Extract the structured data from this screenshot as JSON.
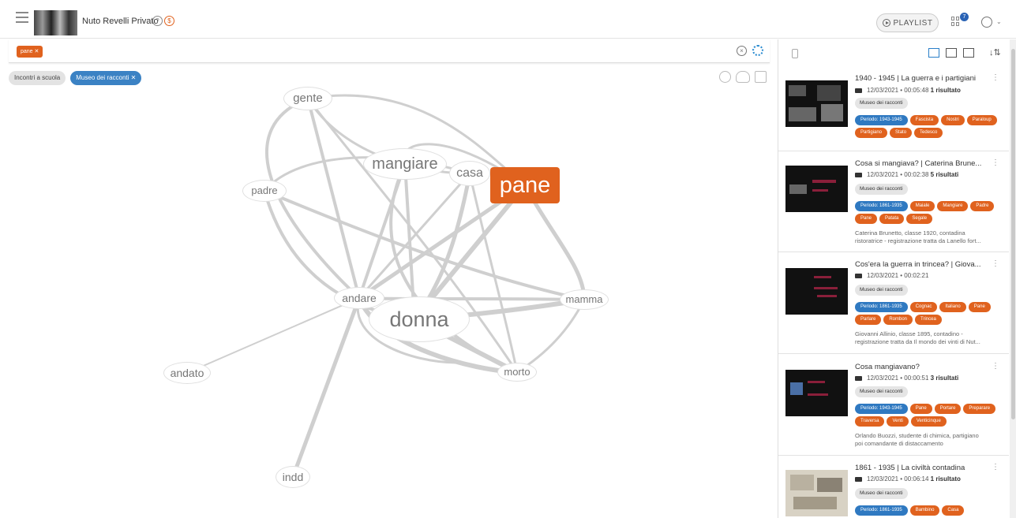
{
  "header": {
    "app_title": "Nuto Revelli Privato",
    "badge_1": "?",
    "badge_2": "$",
    "playlist_label": "PLAYLIST",
    "notification_count": "7"
  },
  "search": {
    "active_tag": "pane ✕",
    "clear_icon": "×"
  },
  "filters": [
    {
      "label": "Incontri a scuola",
      "active": false
    },
    {
      "label": "Museo dei racconti ✕",
      "active": true
    }
  ],
  "graph": {
    "nodes": [
      {
        "id": "gente",
        "label": "gente"
      },
      {
        "id": "mangiare",
        "label": "mangiare"
      },
      {
        "id": "casa",
        "label": "casa"
      },
      {
        "id": "pane",
        "label": "pane",
        "active": true
      },
      {
        "id": "padre",
        "label": "padre"
      },
      {
        "id": "andare",
        "label": "andare"
      },
      {
        "id": "donna",
        "label": "donna"
      },
      {
        "id": "mamma",
        "label": "mamma"
      },
      {
        "id": "andato",
        "label": "andato"
      },
      {
        "id": "morto",
        "label": "morto"
      },
      {
        "id": "indd",
        "label": "indd"
      }
    ]
  },
  "results": [
    {
      "title": "1940 - 1945 | La guerra e i partigiani",
      "date": "12/03/2021 • 00:05:48",
      "count": "1 risultato",
      "source": "Museo dei racconti",
      "tags": [
        {
          "label": "Periodo: 1943-1945",
          "period": true
        },
        {
          "label": "Fascista"
        },
        {
          "label": "Nostri"
        },
        {
          "label": "Paraloup"
        },
        {
          "label": "Partigiano"
        },
        {
          "label": "Stato"
        },
        {
          "label": "Tedesco"
        }
      ],
      "desc": []
    },
    {
      "title": "Cosa si mangiava? | Caterina Brune...",
      "date": "12/03/2021 • 00:02:38",
      "count": "5 risultati",
      "source": "Museo dei racconti",
      "tags": [
        {
          "label": "Periodo: 1861-1935",
          "period": true
        },
        {
          "label": "Maiale"
        },
        {
          "label": "Mangiare"
        },
        {
          "label": "Padre"
        },
        {
          "label": "Pane"
        },
        {
          "label": "Patata"
        },
        {
          "label": "Segale"
        }
      ],
      "desc": [
        "Caterina Brunetto, classe 1920, contadina",
        "ristoratrice - registrazione tratta da Lanello fort..."
      ]
    },
    {
      "title": "Cos'era la guerra in trincea? | Giova...",
      "date": "12/03/2021 • 00:02:21",
      "count": "",
      "source": "Museo dei racconti",
      "tags": [
        {
          "label": "Periodo: 1861-1935",
          "period": true
        },
        {
          "label": "Cognac"
        },
        {
          "label": "Italiano"
        },
        {
          "label": "Pane"
        },
        {
          "label": "Parlare"
        },
        {
          "label": "Rombon"
        },
        {
          "label": "Trincea"
        }
      ],
      "desc": [
        "Giovanni Allinio, classe 1895, contadino -",
        "registrazione tratta da Il mondo dei vinti di Nut..."
      ]
    },
    {
      "title": "Cosa mangiavano?",
      "date": "12/03/2021 • 00:00:51",
      "count": "3 risultati",
      "source": "Museo dei racconti",
      "tags": [
        {
          "label": "Periodo: 1943-1945",
          "period": true
        },
        {
          "label": "Pane"
        },
        {
          "label": "Portare"
        },
        {
          "label": "Preparare"
        },
        {
          "label": "Traversa"
        },
        {
          "label": "Venti"
        },
        {
          "label": "Venticinque"
        }
      ],
      "desc": [
        "Orlando Buozzi, studente di chimica, partigiano",
        "poi comandante di distaccamento"
      ]
    },
    {
      "title": "1861 - 1935 | La civiltà contadina",
      "date": "12/03/2021 • 00:06:14",
      "count": "1 risultato",
      "source": "Museo dei racconti",
      "tags": [
        {
          "label": "Periodo: 1861-1935",
          "period": true
        },
        {
          "label": "Bambino"
        },
        {
          "label": "Casa"
        }
      ],
      "desc": []
    }
  ],
  "colors": {
    "accent_orange": "#e0621e",
    "accent_blue": "#2f79c1"
  }
}
